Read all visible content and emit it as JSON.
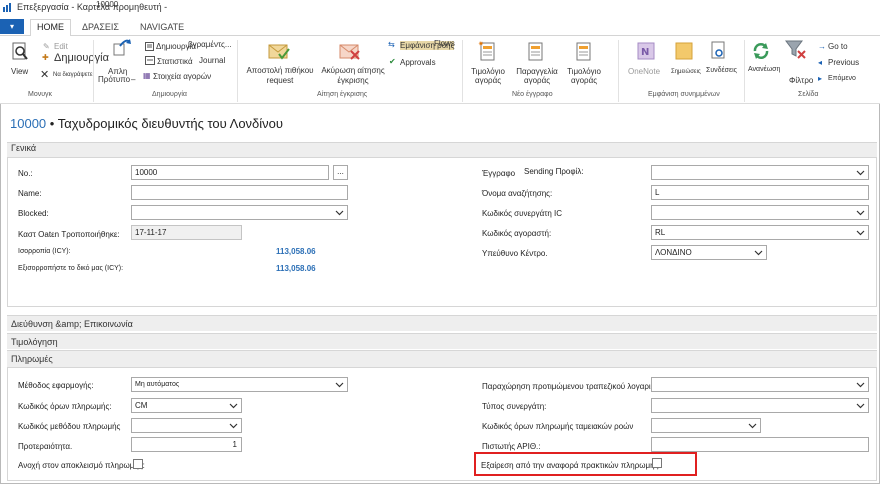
{
  "window": {
    "title": "Επεξεργασία - Καρτέλα προμηθευτή -",
    "title_overlay": "10000"
  },
  "ribbon_tabs": {
    "app_menu": "▾",
    "home": "HOME",
    "actions": "ΔΡΑΣΕΙΣ",
    "navigate": "NAVIGATE"
  },
  "ribbon": {
    "manage": {
      "label": "Μονυγκ",
      "view": "View",
      "edit": "Edit",
      "new": "Δημιουργία",
      "delete": "Να διαγράψετε"
    },
    "create": {
      "label": "Δημιουργία",
      "documents": "Δημιουργία",
      "documents_suffix": "βγραμέντς...",
      "template": "Πρότυπο",
      "journal": "Journal",
      "statistics": "Στατιστικά",
      "purchase_items": "Στοιχεία αγορών",
      "apply": "Απλη"
    },
    "approval": {
      "label": "Αίτηση έγκρισης",
      "send": "Αποστολή πιθήκου",
      "send_request": "request",
      "cancel": "Ακύρωση αίτησης",
      "cancel_approval": "έγκρισης",
      "show_flows": "Εμφάνιση ροής",
      "flows_suffix": "Flows",
      "approvals": "Approvals"
    },
    "new_document": {
      "label": "Νέο έγγραφο",
      "invoice": "Τιμολόγιο",
      "invoice_sub": "αγοράς",
      "order": "Παραγγελία",
      "order_sub": "αγοράς",
      "invoice2": "Τιμολόγιο",
      "invoice2_sub": "αγοράς"
    },
    "show_attached": {
      "label": "Εμφάνιση συνημμένων",
      "onenote": "OneNote",
      "notes": "Σημειώσεις",
      "links": "Συνδέσεις"
    },
    "page": {
      "label": "Σελίδα",
      "refresh": "Ανανέωση",
      "filter": "Φίλτρο",
      "goto": "Go to",
      "previous": "Previous",
      "next": "Επόμενο"
    }
  },
  "page": {
    "number": "10000",
    "title": " • Ταχυδρομικός διευθυντής του Λονδίνου"
  },
  "general": {
    "header": "Γενικά",
    "no_label": "No.:",
    "no_value": "10000",
    "ellipsis": "...",
    "name_label": "Name:",
    "name_value": "",
    "blocked_label": "Blocked:",
    "blocked_value": "",
    "last_modified_label": "Καστ Οatεn Τροποποιήθηκε:",
    "last_modified_value": "17-11-17",
    "balance_label": "Ισορροπία (ICY):",
    "balance_value": "113,058.06",
    "balance_due_label": "Εξισορροπήστε το δικό μας (ICY):",
    "balance_due_value": "113,058.06",
    "doc_sending_label": "Έγγραφο",
    "doc_sending_label2": "Sending Προφίλ:",
    "doc_sending_value": "",
    "search_name_label": "Όνομα αναζήτησης:",
    "search_name_value": "L",
    "ic_partner_label": "Κωδικός συνεργάτη IC",
    "ic_partner_value": "",
    "purchaser_label": "Κωδικός αγοραστή:",
    "purchaser_value": "RL",
    "responsibility_label": "Υπεύθυνο Κέντρο.",
    "responsibility_value": "ΛΟΝΔΙΝΟ"
  },
  "collapsed_sections": {
    "address": "Διεύθυνση &amp; Επικοινωνία",
    "invoicing": "Τιμολόγηση"
  },
  "payments": {
    "header": "Πληρωμές",
    "application_method_label": "Μέθοδος εφαρμογής:",
    "application_method_value": "Μη αυτόματος",
    "payment_terms_label": "Κωδικός όρων πληρωμής:",
    "payment_terms_value": "CM",
    "payment_method_label": "Κωδικός μεθόδου πληρωμής",
    "payment_method_value": "",
    "priority_label": "Προτεραιότητα.",
    "priority_value": "1",
    "block_payment_label": "Ανοχή στον αποκλεισμό πληρωμής:",
    "preferred_bank_label": "Παραχώρηση προτιμώμενου τραπεζικού λογαριασμού:",
    "preferred_bank_value": "",
    "partner_type_label": "Τύπος συνεργάτη:",
    "partner_type_value": "",
    "cash_flow_terms_label": "Κωδικός όρων πληρωμής ταμειακών ροών",
    "cash_flow_terms_value": "",
    "creditor_no_label": "Πιστωτής ΑΡΙΘ.:",
    "creditor_no_value": "",
    "exclude_practices_label": "Εξαίρεση από την αναφορά πρακτικών πληρωμής:"
  },
  "colors": {
    "accent": "#1b62b4",
    "link": "#2b6fb6",
    "highlight": "#e02020"
  }
}
